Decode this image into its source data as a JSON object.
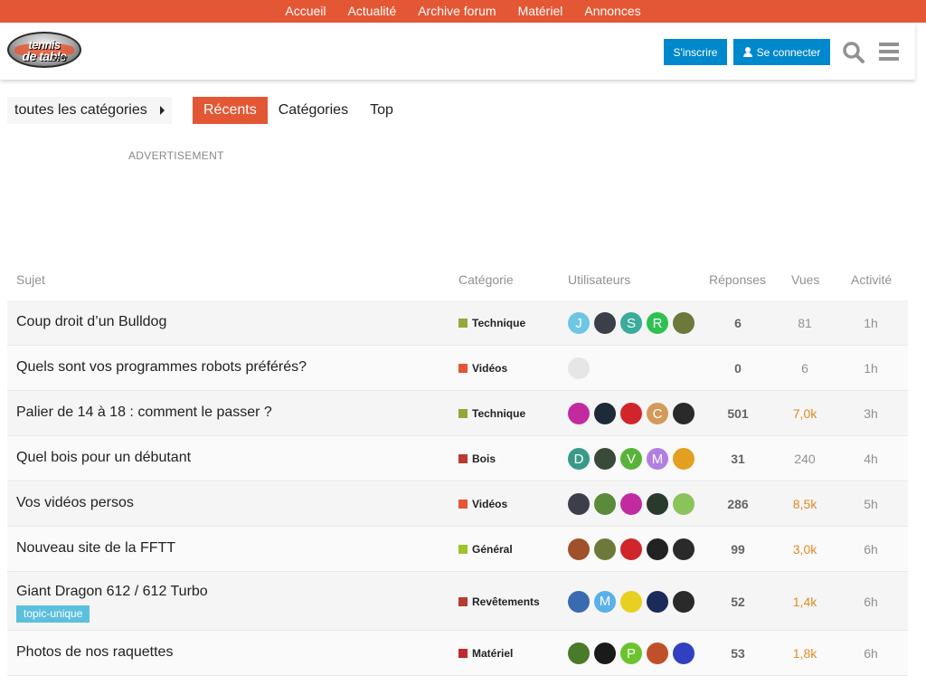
{
  "topnav": {
    "items": [
      "Accueil",
      "Actualité",
      "Archive forum",
      "Matériel",
      "Annonces"
    ]
  },
  "header": {
    "logo": {
      "line1": "tennis",
      "line2": "de table",
      "line3": ".com"
    },
    "signup_label": "S'inscrire",
    "login_label": "Se connecter"
  },
  "filters": {
    "category_select": "toutes les catégories",
    "tabs": [
      "Récents",
      "Catégories",
      "Top"
    ],
    "active_tab": "Récents"
  },
  "advertisement_label": "ADVERTISEMENT",
  "table": {
    "columns": {
      "topic": "Sujet",
      "category": "Catégorie",
      "users": "Utilisateurs",
      "replies": "Réponses",
      "views": "Vues",
      "activity": "Activité"
    },
    "rows": [
      {
        "title": "Coup droit d’un Bulldog",
        "category": "Technique",
        "category_color": "#92a83a",
        "avatars": [
          {
            "letter": "J",
            "color": "#6dc6e3"
          },
          {
            "letter": "",
            "color": "#3a3f4a"
          },
          {
            "letter": "S",
            "color": "#3bab9c"
          },
          {
            "letter": "R",
            "color": "#2fc152"
          },
          {
            "letter": "",
            "color": "#6b7a3a"
          }
        ],
        "replies": "6",
        "views": "81",
        "views_hot": false,
        "activity": "1h"
      },
      {
        "title": "Quels sont vos programmes robots préférés?",
        "category": "Vidéos",
        "category_color": "#e45735",
        "avatars": [
          {
            "letter": "",
            "color": "#e6e6e6"
          }
        ],
        "replies": "0",
        "views": "6",
        "views_hot": false,
        "activity": "1h"
      },
      {
        "title": "Palier de 14 à 18 : comment le passer ?",
        "category": "Technique",
        "category_color": "#92a83a",
        "avatars": [
          {
            "letter": "",
            "color": "#c22ba0"
          },
          {
            "letter": "",
            "color": "#1c2a3a"
          },
          {
            "letter": "",
            "color": "#d0262b"
          },
          {
            "letter": "C",
            "color": "#d39a5a"
          },
          {
            "letter": "",
            "color": "#2a2a2a"
          }
        ],
        "replies": "501",
        "views": "7,0k",
        "views_hot": true,
        "activity": "3h"
      },
      {
        "title": "Quel bois pour un débutant",
        "category": "Bois",
        "category_color": "#b83a30",
        "avatars": [
          {
            "letter": "D",
            "color": "#3a9a8a"
          },
          {
            "letter": "",
            "color": "#3a4a3a"
          },
          {
            "letter": "V",
            "color": "#58b33a"
          },
          {
            "letter": "M",
            "color": "#b27ee3"
          },
          {
            "letter": "",
            "color": "#e3a020"
          }
        ],
        "replies": "31",
        "views": "240",
        "views_hot": false,
        "activity": "4h"
      },
      {
        "title": "Vos vidéos persos",
        "category": "Vidéos",
        "category_color": "#e45735",
        "avatars": [
          {
            "letter": "",
            "color": "#3a3f4a"
          },
          {
            "letter": "",
            "color": "#5a8a3a"
          },
          {
            "letter": "",
            "color": "#c22ba0"
          },
          {
            "letter": "",
            "color": "#2a3a2a"
          },
          {
            "letter": "",
            "color": "#8ac35a"
          }
        ],
        "replies": "286",
        "views": "8,5k",
        "views_hot": true,
        "activity": "5h"
      },
      {
        "title": "Nouveau site de la FFTT",
        "category": "Général",
        "category_color": "#9dc32e",
        "avatars": [
          {
            "letter": "",
            "color": "#a0502a"
          },
          {
            "letter": "",
            "color": "#6b7a3a"
          },
          {
            "letter": "",
            "color": "#d0262b"
          },
          {
            "letter": "",
            "color": "#222222"
          },
          {
            "letter": "",
            "color": "#2a2a2a"
          }
        ],
        "replies": "99",
        "views": "3,0k",
        "views_hot": true,
        "activity": "6h"
      },
      {
        "title": "Giant Dragon 612 / 612 Turbo",
        "tag": "topic-unique",
        "category": "Revêtements",
        "category_color": "#b83a30",
        "avatars": [
          {
            "letter": "",
            "color": "#3a6ab0"
          },
          {
            "letter": "M",
            "color": "#5ab0e8"
          },
          {
            "letter": "",
            "color": "#e8d020"
          },
          {
            "letter": "",
            "color": "#1a2a5a"
          },
          {
            "letter": "",
            "color": "#2a2a2a"
          }
        ],
        "replies": "52",
        "views": "1,4k",
        "views_hot": true,
        "activity": "6h"
      },
      {
        "title": "Photos de nos raquettes",
        "category": "Matériel",
        "category_color": "#c0282f",
        "avatars": [
          {
            "letter": "",
            "color": "#4a7a2a"
          },
          {
            "letter": "",
            "color": "#1a1a1a"
          },
          {
            "letter": "P",
            "color": "#6bc32e"
          },
          {
            "letter": "",
            "color": "#c0502a"
          },
          {
            "letter": "",
            "color": "#3040c0"
          }
        ],
        "replies": "53",
        "views": "1,8k",
        "views_hot": true,
        "activity": "6h"
      }
    ]
  }
}
